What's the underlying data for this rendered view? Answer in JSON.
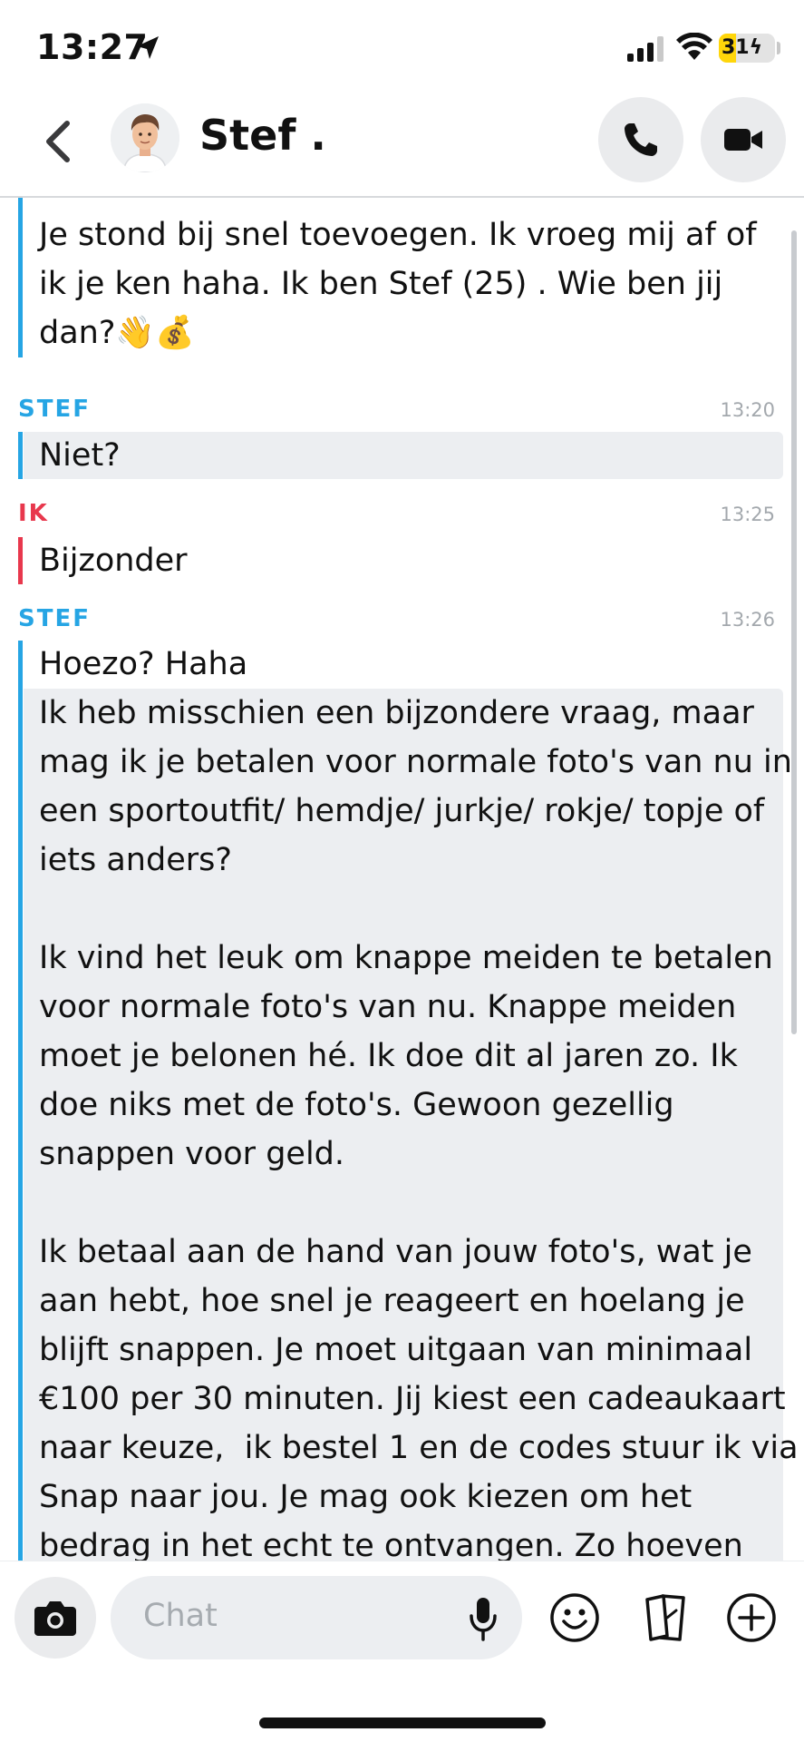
{
  "status_bar": {
    "time": "13:27",
    "battery_level": 31,
    "battery_charging": true,
    "icons": [
      "location-arrow-icon",
      "cellular-signal-icon",
      "wifi-icon",
      "battery-icon"
    ]
  },
  "header": {
    "contact_name": "Stef .",
    "icons": [
      "back-chevron-icon",
      "avatar",
      "phone-icon",
      "video-camera-icon"
    ]
  },
  "messages": {
    "m0": {
      "sender": "",
      "lines": [
        "Je stond bij snel toevoegen. Ik vroeg mij af of",
        "ik je ken haha. Ik ben Stef (25) . Wie ben jij",
        "dan?👋💰"
      ]
    },
    "m1": {
      "sender": "STEF",
      "time": "13:20",
      "lines": [
        "Niet?"
      ]
    },
    "m2": {
      "sender": "IK",
      "time": "13:25",
      "lines": [
        "Bijzonder"
      ]
    },
    "m3": {
      "sender": "STEF",
      "time": "13:26",
      "lines": [
        "Hoezo? Haha"
      ]
    },
    "m4": {
      "sender": "STEF",
      "lines": [
        "Ik heb misschien een bijzondere vraag, maar",
        "mag ik je betalen voor normale foto's van nu in",
        "een sportoutfit/ hemdje/ jurkje/ rokje/ topje of",
        "iets anders?",
        "",
        "Ik vind het leuk om knappe meiden te betalen",
        "voor normale foto's van nu. Knappe meiden",
        "moet je belonen hé. Ik doe dit al jaren zo. Ik",
        "doe niks met de foto's. Gewoon gezellig",
        "snappen voor geld.",
        "",
        "Ik betaal aan de hand van jouw foto's, wat je",
        "aan hebt, hoe snel je reageert en hoelang je",
        "blijft snappen. Je moet uitgaan van minimaal",
        "€100 per 30 minuten. Jij kiest een cadeaukaart",
        "naar keuze,  ik bestel 1 en de codes stuur ik via",
        "Snap naar jou. Je mag ook kiezen om het",
        "bedrag in het echt te ontvangen. Zo hoeven"
      ]
    }
  },
  "composer": {
    "placeholder": "Chat",
    "icons": [
      "camera-icon",
      "microphone-icon",
      "emoji-icon",
      "cards-icon",
      "plus-icon"
    ]
  },
  "colors": {
    "stef": "#26a5e4",
    "ik": "#e8384d",
    "bubble_grey": "#eceef1",
    "battery_yellow": "#ffd60a"
  }
}
